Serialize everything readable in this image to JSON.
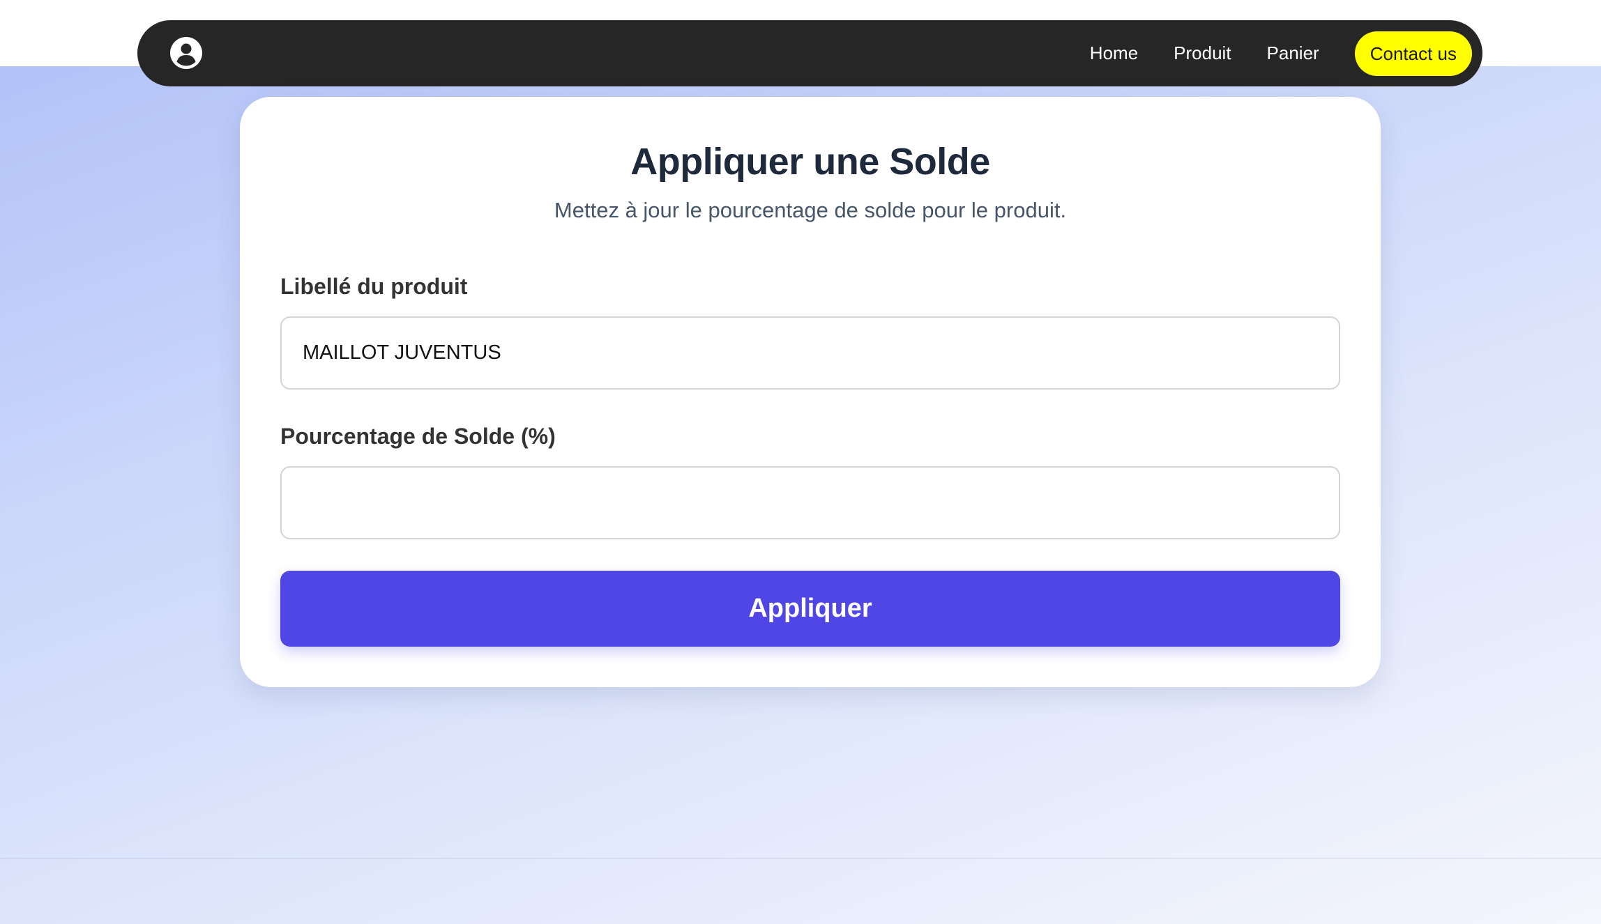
{
  "nav": {
    "logo_icon": "user-circle-icon",
    "links": [
      "Home",
      "Produit",
      "Panier"
    ],
    "contact_label": "Contact us"
  },
  "form": {
    "title": "Appliquer une Solde",
    "subtitle": "Mettez à jour le pourcentage de solde pour le produit.",
    "product_label": "Libellé du produit",
    "product_value": "MAILLOT JUVENTUS",
    "percent_label": "Pourcentage de Solde (%)",
    "percent_value": "",
    "submit_label": "Appliquer"
  },
  "colors": {
    "navbar": "#262626",
    "contact_button": "#ffff00",
    "primary_button": "#4f46e5",
    "title_text": "#1e293b"
  }
}
